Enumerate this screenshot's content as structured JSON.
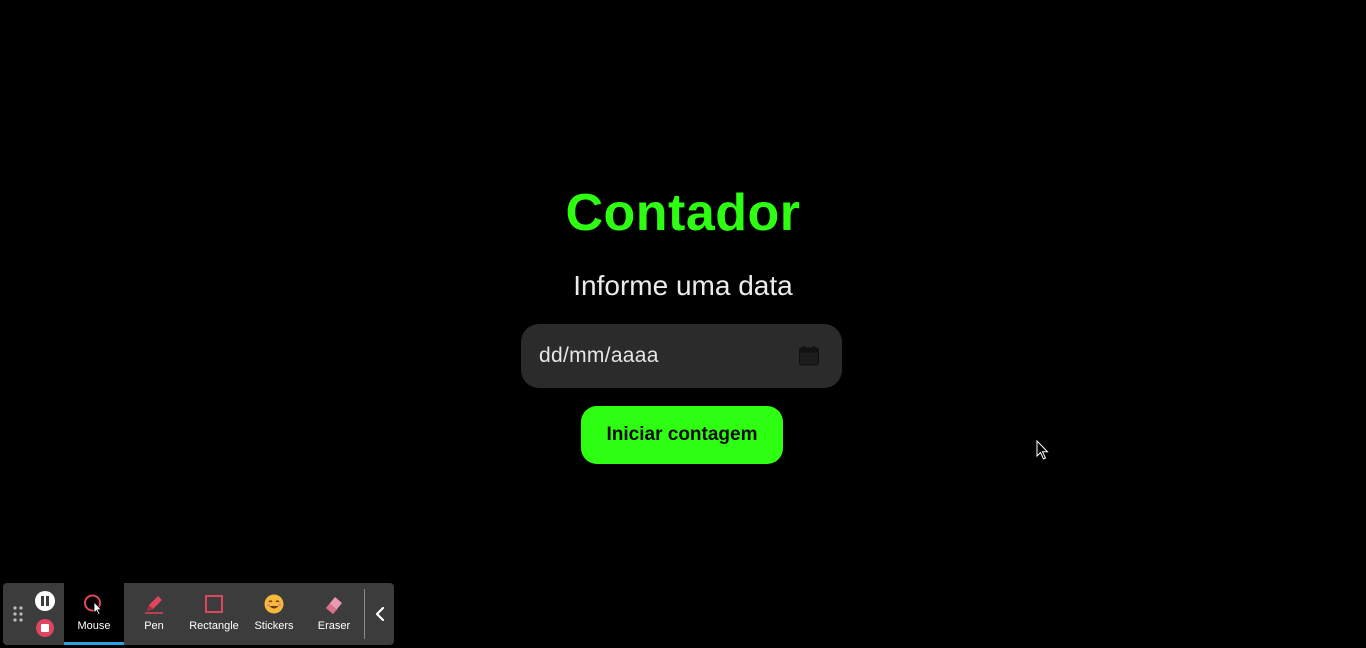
{
  "app": {
    "title": "Contador",
    "subtitle": "Informe uma data"
  },
  "date_field": {
    "placeholder": "dd/mm/aaaa",
    "icon": "calendar-icon"
  },
  "start_button": {
    "label": "Iniciar contagem"
  },
  "colors": {
    "accent": "#2eff12",
    "background": "#000000",
    "field_background": "#2b2b2b",
    "toolbar_background": "#3c3c3c",
    "active_tool_indicator": "#2aa3e0",
    "stop_color": "#e0455e"
  },
  "toolbar": {
    "controls": {
      "pause_icon": "pause-icon",
      "stop_icon": "stop-icon",
      "drag_icon": "drag-handle-icon",
      "collapse_icon": "chevron-left-icon"
    },
    "tools": [
      {
        "label": "Mouse",
        "icon": "mouse-pointer-icon",
        "active": true
      },
      {
        "label": "Pen",
        "icon": "pen-icon",
        "active": false
      },
      {
        "label": "Rectangle",
        "icon": "rectangle-icon",
        "active": false
      },
      {
        "label": "Stickers",
        "icon": "sticker-icon",
        "active": false
      },
      {
        "label": "Eraser",
        "icon": "eraser-icon",
        "active": false
      }
    ]
  }
}
